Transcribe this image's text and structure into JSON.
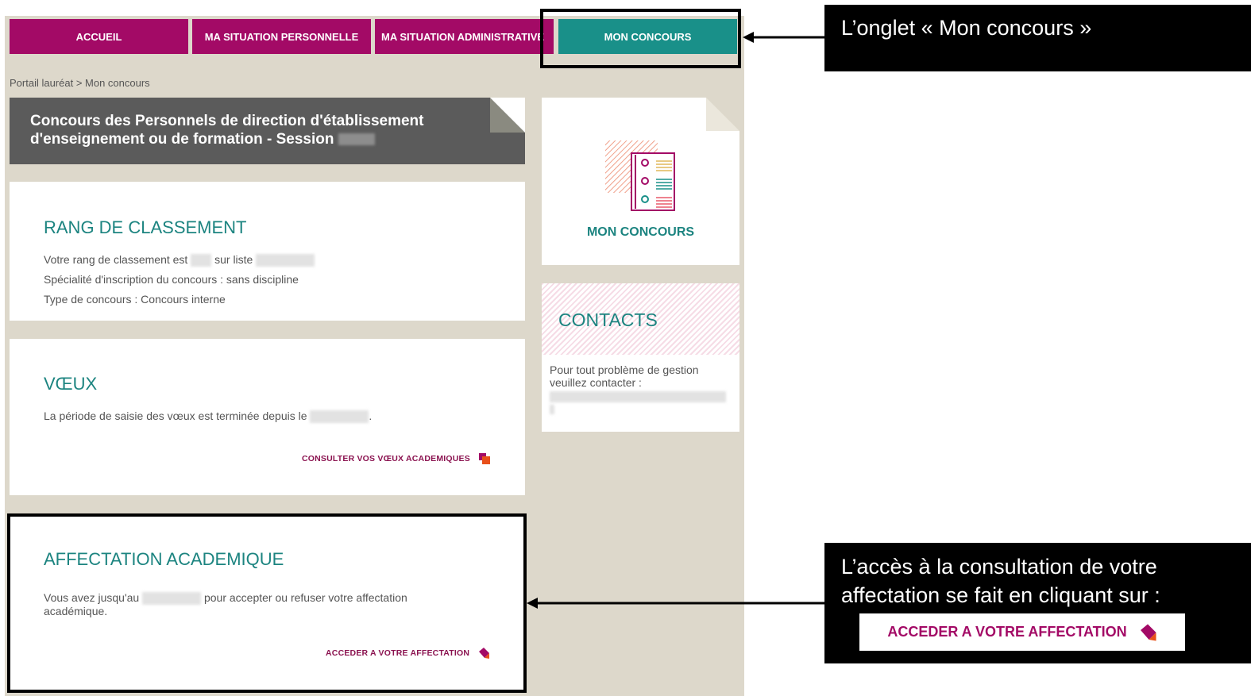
{
  "nav": {
    "tabs": [
      {
        "label": "ACCUEIL"
      },
      {
        "label": "MA SITUATION PERSONNELLE"
      },
      {
        "label": "MA SITUATION ADMINISTRATIVE"
      },
      {
        "label": "MON CONCOURS",
        "active": true
      }
    ]
  },
  "breadcrumb": "Portail lauréat > Mon concours",
  "banner": {
    "title": "Concours des Personnels de direction d'établissement d'enseignement ou de formation - Session"
  },
  "ranking": {
    "heading": "RANG DE CLASSEMENT",
    "line1_prefix": "Votre rang de classement est",
    "line1_mid": "sur liste",
    "line2": "Spécialité d'inscription du concours : sans discipline",
    "line3": "Type de concours : Concours interne"
  },
  "wishes": {
    "heading": "VŒUX",
    "text": "La période de saisie des vœux est terminée depuis le",
    "text_end": ".",
    "link": "CONSULTER VOS VŒUX ACADEMIQUES"
  },
  "assignment": {
    "heading": "AFFECTATION ACADEMIQUE",
    "text_prefix": "Vous avez jusqu'au",
    "text_suffix": "pour accepter ou refuser votre affectation",
    "text_line2": "académique.",
    "link": "ACCEDER A VOTRE AFFECTATION"
  },
  "sidebar": {
    "tile_label": "MON CONCOURS",
    "contacts_heading": "CONTACTS",
    "contacts_text": "Pour tout problème de gestion veuillez contacter :"
  },
  "annotations": {
    "tab_callout": "L’onglet « Mon concours »",
    "affectation_callout": "L’accès à la consultation de votre affectation se fait en cliquant sur :",
    "affectation_button": "ACCEDER A VOTRE AFFECTATION"
  },
  "colors": {
    "brand_magenta": "#a30a66",
    "brand_teal": "#199089",
    "link_purple": "#8b1350",
    "page_bg": "#ddd8cb"
  },
  "icons": {
    "wishes_link": "copy-icon",
    "assignment_link": "pencil-icon",
    "tile": "document-list-icon"
  }
}
